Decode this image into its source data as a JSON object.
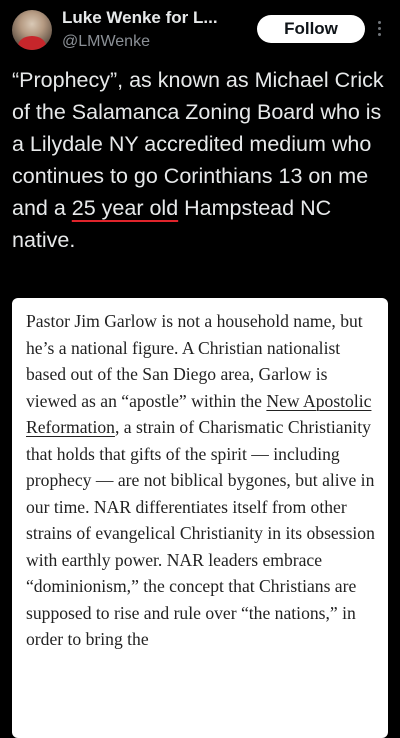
{
  "tweet": {
    "author": {
      "display_name": "Luke Wenke for L...",
      "handle": "@LMWenke"
    },
    "follow_label": "Follow",
    "text": {
      "before_underline": "“Prophecy”, as known as Michael Crick of the Salamanca Zoning Board who is a Lilydale NY accredited medium who continues to go Corinthians 13 on me and a ",
      "underlined": "25 year old",
      "after_underline": " Hampstead NC native."
    }
  },
  "article": {
    "p1": "Pastor Jim Garlow is not a household name, but he’s a national figure. A Christian nationalist based out of the San Diego area, Garlow is viewed as an “apostle” within the ",
    "link": "New Apostolic Reformation",
    "p2": ", a strain of Charismatic Christianity that holds that gifts of the spirit — including prophecy — are not biblical bygones, but alive in our time. NAR differentiates itself from other strains of evangelical Christianity in its obsession with earthly power. NAR leaders embrace “dominionism,” the concept that Christians are supposed to rise and rule over “the nations,” in order to bring the"
  },
  "colors": {
    "background": "#000000",
    "underline_accent": "#e0242b",
    "card": "#ffffff"
  }
}
